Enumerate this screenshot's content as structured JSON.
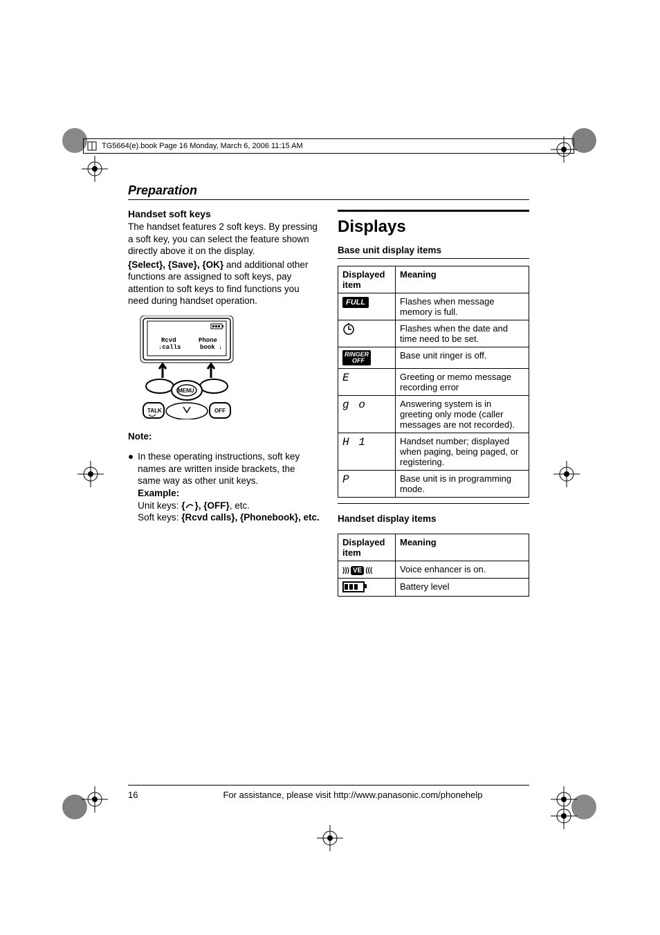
{
  "print_header": "TG5664(e).book  Page 16  Monday, March 6, 2006  11:15 AM",
  "section_title": "Preparation",
  "left": {
    "softkeys_head": "Handset soft keys",
    "p1": "The handset features 2 soft keys. By pressing a soft key, you can select the feature shown directly above it on the display.",
    "p2a": "{Select}, {Save}, {OK}",
    "p2b": " and additional other functions are assigned to soft keys, pay attention to soft keys to find functions you need during handset operation.",
    "screen_rcvd": "Rcvd",
    "screen_calls": "calls",
    "screen_phone": "Phone",
    "screen_book": "book",
    "menu": "MENU",
    "talk": "TALK",
    "off": "OFF",
    "note": "Note:",
    "bullet1": "In these operating instructions, soft key names are written inside brackets, the same way as other unit keys.",
    "example": "Example:",
    "unitkeys_lbl": "Unit keys: ",
    "unitkeys_val": "{↷}, {OFF}, etc.",
    "softkeys_lbl": "Soft keys: ",
    "softkeys_val": "{Rcvd calls}, {Phonebook}, etc."
  },
  "right": {
    "title": "Displays",
    "base_sub": "Base unit display items",
    "th1": "Displayed item",
    "th2": "Meaning",
    "rows": [
      {
        "icon": "FULL",
        "meaning": "Flashes when message memory is full."
      },
      {
        "icon": "clock",
        "meaning": "Flashes when the date and time need to be set."
      },
      {
        "icon": "RINGER",
        "meaning": "Base unit ringer is off."
      },
      {
        "icon": "E",
        "meaning": "Greeting or memo message recording error"
      },
      {
        "icon": "go",
        "meaning": "Answering system is in greeting only mode (caller messages are not recorded)."
      },
      {
        "icon": "H1",
        "meaning": "Handset number; displayed when paging, being paged, or registering."
      },
      {
        "icon": "P",
        "meaning": "Base unit is in programming mode."
      }
    ],
    "handset_sub": "Handset display items",
    "hrows": [
      {
        "icon": "VE",
        "meaning": "Voice enhancer is on."
      },
      {
        "icon": "BATT",
        "meaning": "Battery level"
      }
    ]
  },
  "footer": {
    "page": "16",
    "text": "For assistance, please visit http://www.panasonic.com/phonehelp"
  }
}
